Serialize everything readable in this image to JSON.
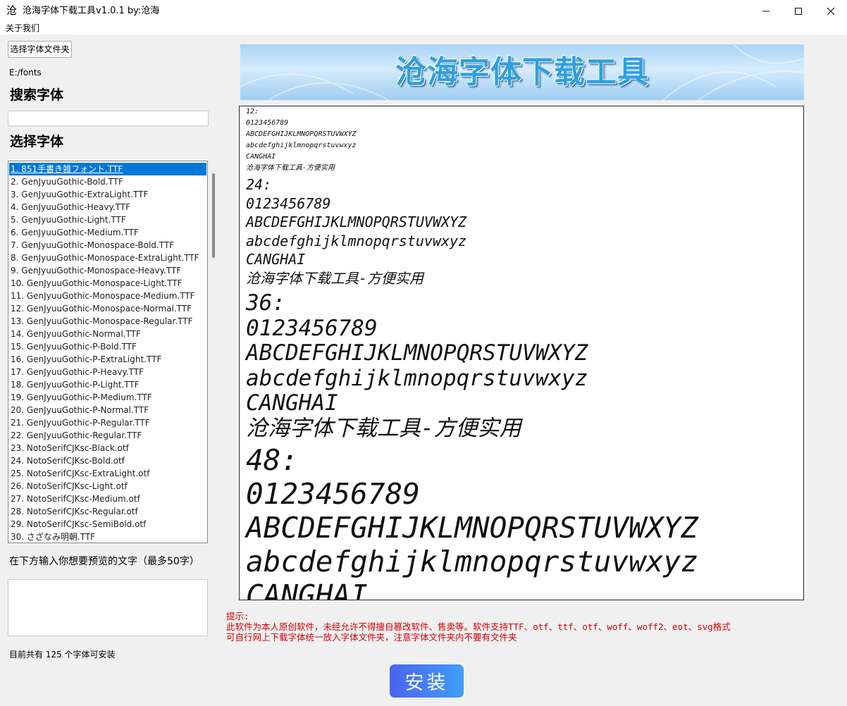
{
  "window": {
    "icon_char": "沧",
    "title": "沧海字体下载工具v1.0.1 by:沧海"
  },
  "menu": {
    "about": "关于我们"
  },
  "left": {
    "choose_folder_label": "选择字体文件夹",
    "folder_path": "E:/fonts",
    "search_heading": "搜索字体",
    "search_value": "",
    "select_heading": "选择字体",
    "fonts": [
      "1. 851手書き雑フォント.TTF",
      "2. GenJyuuGothic-Bold.TTF",
      "3. GenJyuuGothic-ExtraLight.TTF",
      "4. GenJyuuGothic-Heavy.TTF",
      "5. GenJyuuGothic-Light.TTF",
      "6. GenJyuuGothic-Medium.TTF",
      "7. GenJyuuGothic-Monospace-Bold.TTF",
      "8. GenJyuuGothic-Monospace-ExtraLight.TTF",
      "9. GenJyuuGothic-Monospace-Heavy.TTF",
      "10. GenJyuuGothic-Monospace-Light.TTF",
      "11. GenJyuuGothic-Monospace-Medium.TTF",
      "12. GenJyuuGothic-Monospace-Normal.TTF",
      "13. GenJyuuGothic-Monospace-Regular.TTF",
      "14. GenJyuuGothic-Normal.TTF",
      "15. GenJyuuGothic-P-Bold.TTF",
      "16. GenJyuuGothic-P-ExtraLight.TTF",
      "17. GenJyuuGothic-P-Heavy.TTF",
      "18. GenJyuuGothic-P-Light.TTF",
      "19. GenJyuuGothic-P-Medium.TTF",
      "20. GenJyuuGothic-P-Normal.TTF",
      "21. GenJyuuGothic-P-Regular.TTF",
      "22. GenJyuuGothic-Regular.TTF",
      "23. NotoSerifCJKsc-Black.otf",
      "24. NotoSerifCJKsc-Bold.otf",
      "25. NotoSerifCJKsc-ExtraLight.otf",
      "26. NotoSerifCJKsc-Light.otf",
      "27. NotoSerifCJKsc-Medium.otf",
      "28. NotoSerifCJKsc-Regular.otf",
      "29. NotoSerifCJKsc-SemiBold.otf",
      "30. さざなみ明朝.TTF"
    ],
    "selected_index": 0,
    "preview_prompt": "在下方输入你想要预览的文字（最多50字）",
    "preview_text_value": "",
    "font_count": "目前共有 125 个字体可安装"
  },
  "banner": {
    "title": "沧海字体下载工具"
  },
  "preview": {
    "blocks": [
      {
        "size_label": "12:",
        "lines": [
          "0123456789",
          "ABCDEFGHIJKLMNOPQRSTUVWXYZ",
          "abcdefghijklmnopqrstuvwxyz",
          "CANGHAI",
          "沧海字体下载工具-方便实用"
        ]
      },
      {
        "size_label": "24:",
        "lines": [
          "0123456789",
          "ABCDEFGHIJKLMNOPQRSTUVWXYZ",
          "abcdefghijklmnopqrstuvwxyz",
          "CANGHAI",
          "沧海字体下载工具-方便实用"
        ]
      },
      {
        "size_label": "36:",
        "lines": [
          "0123456789",
          "ABCDEFGHIJKLMNOPQRSTUVWXYZ",
          "abcdefghijklmnopqrstuvwxyz",
          "CANGHAI",
          "沧海字体下载工具-方便实用"
        ]
      },
      {
        "size_label": "48:",
        "lines": [
          "0123456789",
          "ABCDEFGHIJKLMNOPQRSTUVWXYZ",
          "abcdefghijklmnopqrstuvwxyz",
          "CANGHAI"
        ]
      }
    ]
  },
  "notes": {
    "label": "提示:",
    "line1": "此软件为本人原创软件，未经允许不得擅自篡改软件、售卖等。软件支持TTF、otf、ttf、otf、woff、woff2、eot、svg格式",
    "line2": "可自行网上下载字体统一放入字体文件夹，注意字体文件夹内不要有文件夹"
  },
  "install_label": "安装",
  "colors": {
    "accent_selected": "#0078d7",
    "notes_red": "#d40000",
    "install_gradient_start": "#4b63f0",
    "install_gradient_end": "#3f9ff7",
    "banner_text": "#2f9fe0"
  }
}
